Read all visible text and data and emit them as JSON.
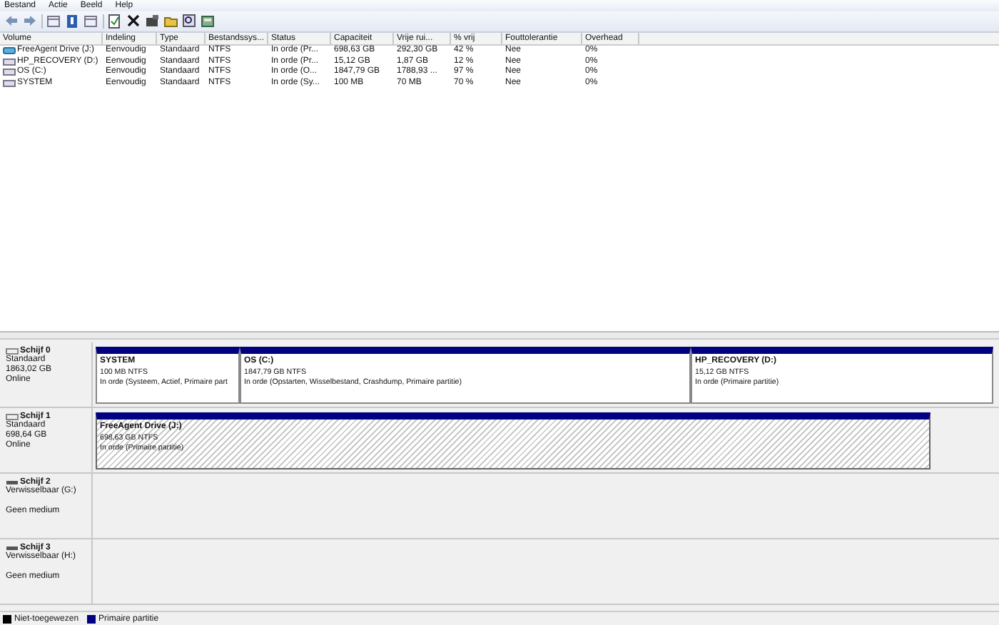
{
  "menu": [
    "Bestand",
    "Actie",
    "Beeld",
    "Help"
  ],
  "table": {
    "columns": [
      "Volume",
      "Indeling",
      "Type",
      "Bestandssys...",
      "Status",
      "Capaciteit",
      "Vrije rui...",
      "% vrij",
      "Fouttolerantie",
      "Overhead"
    ],
    "rows": [
      {
        "cells": [
          "FreeAgent Drive (J:)",
          "Eenvoudig",
          "Standaard",
          "NTFS",
          "In orde (Pr...",
          "698,63 GB",
          "292,30 GB",
          "42 %",
          "Nee",
          "0%"
        ],
        "kind": "external"
      },
      {
        "cells": [
          "HP_RECOVERY (D:)",
          "Eenvoudig",
          "Standaard",
          "NTFS",
          "In orde (Pr...",
          "15,12 GB",
          "1,87 GB",
          "12 %",
          "Nee",
          "0%"
        ],
        "kind": "internal"
      },
      {
        "cells": [
          "OS (C:)",
          "Eenvoudig",
          "Standaard",
          "NTFS",
          "In orde (O...",
          "1847,79 GB",
          "1788,93 ...",
          "97 %",
          "Nee",
          "0%"
        ],
        "kind": "internal"
      },
      {
        "cells": [
          "SYSTEM",
          "Eenvoudig",
          "Standaard",
          "NTFS",
          "In orde (Sy...",
          "100 MB",
          "70 MB",
          "70 %",
          "Nee",
          "0%"
        ],
        "kind": "internal"
      }
    ]
  },
  "disks": [
    {
      "name": "Schijf 0",
      "type": "Standaard",
      "size": "1863,02 GB",
      "state": "Online",
      "kind": "fixed",
      "partitions": [
        {
          "title": "SYSTEM",
          "size": "100 MB NTFS",
          "status": "In orde (Systeem, Actief, Primaire part",
          "selected": false
        },
        {
          "title": "OS  (C:)",
          "size": "1847,79 GB NTFS",
          "status": "In orde (Opstarten, Wisselbestand, Crashdump, Primaire partitie)",
          "selected": false
        },
        {
          "title": "HP_RECOVERY  (D:)",
          "size": "15,12 GB NTFS",
          "status": "In orde (Primaire partitie)",
          "selected": false
        }
      ]
    },
    {
      "name": "Schijf 1",
      "type": "Standaard",
      "size": "698,64 GB",
      "state": "Online",
      "kind": "fixed",
      "partitions": [
        {
          "title": "FreeAgent Drive  (J:)",
          "size": "698,63 GB NTFS",
          "status": "In orde (Primaire partitie)",
          "selected": true
        }
      ]
    },
    {
      "name": "Schijf 2",
      "type": "Verwisselbaar (G:)",
      "state": "Geen medium",
      "kind": "removable"
    },
    {
      "name": "Schijf 3",
      "type": "Verwisselbaar (H:)",
      "state": "Geen medium",
      "kind": "removable"
    }
  ],
  "legend": [
    {
      "label": "Niet-toegewezen",
      "color": "#000000"
    },
    {
      "label": "Primaire partitie",
      "color": "#000080"
    }
  ]
}
